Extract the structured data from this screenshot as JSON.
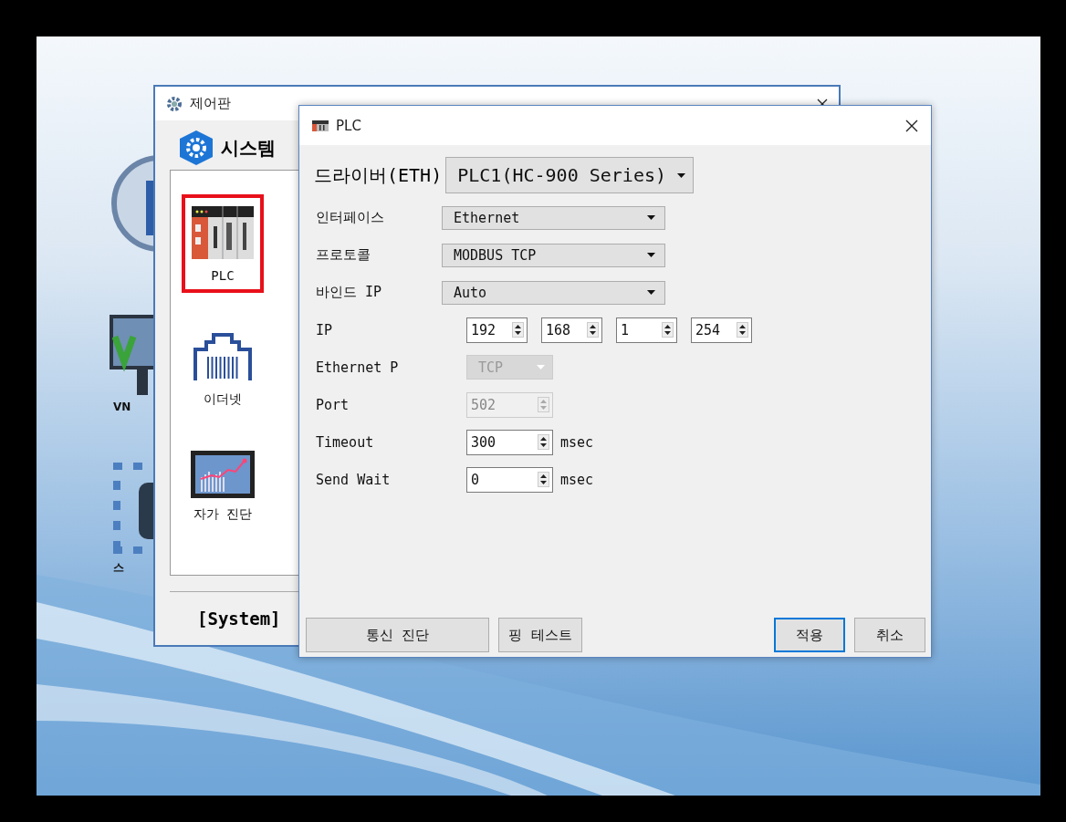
{
  "desktop": {
    "icons": [
      {
        "kind": "circle"
      },
      {
        "kind": "vnc",
        "label": "VN"
      },
      {
        "kind": "frame",
        "label": "스"
      }
    ]
  },
  "control_panel": {
    "title": "제어판",
    "section": "시스템",
    "items": [
      {
        "kind": "plc",
        "label": "PLC",
        "selected": true
      },
      {
        "kind": "ethernet",
        "label": "이더넷",
        "selected": false
      },
      {
        "kind": "diagnosis",
        "label": "자가 진단",
        "selected": false
      }
    ],
    "footer": "[System]"
  },
  "plc_dialog": {
    "title": "PLC",
    "driver_label": "드라이버(ETH)",
    "driver_value": "PLC1(HC-900 Series)",
    "fields": [
      {
        "kind": "select",
        "label": "인터페이스",
        "value": "Ethernet",
        "disabled": false
      },
      {
        "kind": "select",
        "label": "프로토콜",
        "value": "MODBUS TCP",
        "disabled": false
      },
      {
        "kind": "select",
        "label": "바인드 IP",
        "value": "Auto",
        "disabled": false
      },
      {
        "kind": "ip",
        "label": "IP",
        "octets": [
          "192",
          "168",
          "1",
          "254"
        ]
      },
      {
        "kind": "small_select",
        "label": "Ethernet P",
        "value": "TCP",
        "disabled": true
      },
      {
        "kind": "spin",
        "label": "Port",
        "value": "502",
        "disabled": true
      },
      {
        "kind": "spin",
        "label": "Timeout",
        "value": "300",
        "unit": "msec",
        "disabled": false
      },
      {
        "kind": "spin",
        "label": "Send Wait",
        "value": "0",
        "unit": "msec",
        "disabled": false
      }
    ],
    "left_buttons": [
      {
        "label": "통신 진단",
        "default": false
      },
      {
        "label": "핑 테스트",
        "default": false
      }
    ],
    "right_buttons": [
      {
        "label": "적용",
        "default": true
      },
      {
        "label": "취소",
        "default": false
      }
    ]
  }
}
